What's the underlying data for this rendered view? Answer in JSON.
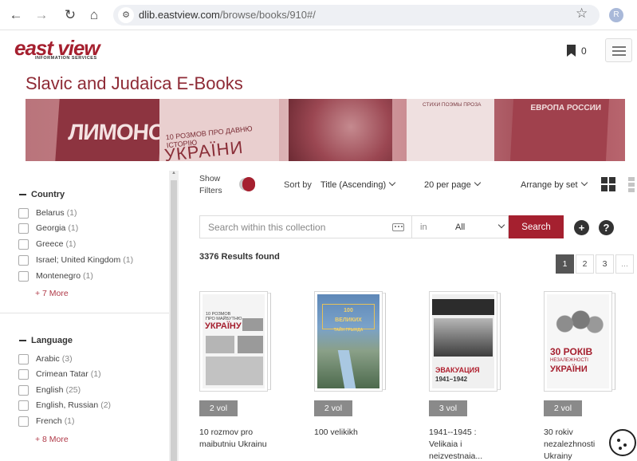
{
  "browser": {
    "url_host": "dlib.eastview.com",
    "url_path": "/browse/books/910#/",
    "profile_initial": "R"
  },
  "header": {
    "logo_text": "east view",
    "logo_sub": "INFORMATION SERVICES",
    "bookmark_count": "0"
  },
  "page_title": "Slavic and Judaica E-Books",
  "banner": {
    "texts": [
      "ЛИМОНОВ",
      "10 РОЗМОВ ПРО ДАВНЮ ІСТОРІЮ",
      "УКРАЇНИ",
      "СТИХИ ПОЭМЫ ПРОЗА",
      "ЕВРОПА РОССИИ"
    ]
  },
  "sidebar": {
    "country": {
      "title": "Country",
      "items": [
        {
          "label": "Belarus",
          "count": "(1)"
        },
        {
          "label": "Georgia",
          "count": "(1)"
        },
        {
          "label": "Greece",
          "count": "(1)"
        },
        {
          "label": "Israel; United Kingdom",
          "count": "(1)"
        },
        {
          "label": "Montenegro",
          "count": "(1)"
        }
      ],
      "more": "+ 7 More"
    },
    "language": {
      "title": "Language",
      "items": [
        {
          "label": "Arabic",
          "count": "(3)"
        },
        {
          "label": "Crimean Tatar",
          "count": "(1)"
        },
        {
          "label": "English",
          "count": "(25)"
        },
        {
          "label": "English, Russian",
          "count": "(2)"
        },
        {
          "label": "French",
          "count": "(1)"
        }
      ],
      "more": "+ 8 More"
    }
  },
  "toolbar": {
    "show_filters_line1": "Show",
    "show_filters_line2": "Filters",
    "sort_label": "Sort by",
    "sort_value": "Title (Ascending)",
    "per_page": "20 per page",
    "arrange": "Arrange by set"
  },
  "search": {
    "placeholder": "Search within this collection",
    "in_label": "in",
    "scope": "All",
    "button": "Search",
    "add": "+",
    "help": "?"
  },
  "results": {
    "count_text": "3376 Results found",
    "pages": [
      "1",
      "2",
      "3",
      "..."
    ],
    "active_page": "1"
  },
  "books": [
    {
      "vol": "2 vol",
      "title": "10 rozmov pro maibutniu Ukrainu",
      "cover_text": [
        "10 РОЗМОВ",
        "ПРО МАЙБУТНЮ",
        "УКРАЇНУ"
      ]
    },
    {
      "vol": "2 vol",
      "title": "100 velikikh",
      "cover_text": [
        "100",
        "ВЕЛИКИХ",
        "ТАЙН ГРЫНДА"
      ]
    },
    {
      "vol": "3 vol",
      "title": "1941--1945 : Velikaia i neizvestnaia...",
      "cover_text": [
        "ЭВАКУАЦИЯ",
        "1941–1942"
      ]
    },
    {
      "vol": "2 vol",
      "title": "30 rokiv nezalezhnosti Ukrainy",
      "cover_text": [
        "30 РОКІВ",
        "НЕЗАЛЕЖНОСТІ",
        "УКРАЇНИ"
      ]
    }
  ],
  "colors": {
    "brand": "#a5202f",
    "title": "#8e2a35",
    "vol_badge": "#8a8a8a"
  }
}
